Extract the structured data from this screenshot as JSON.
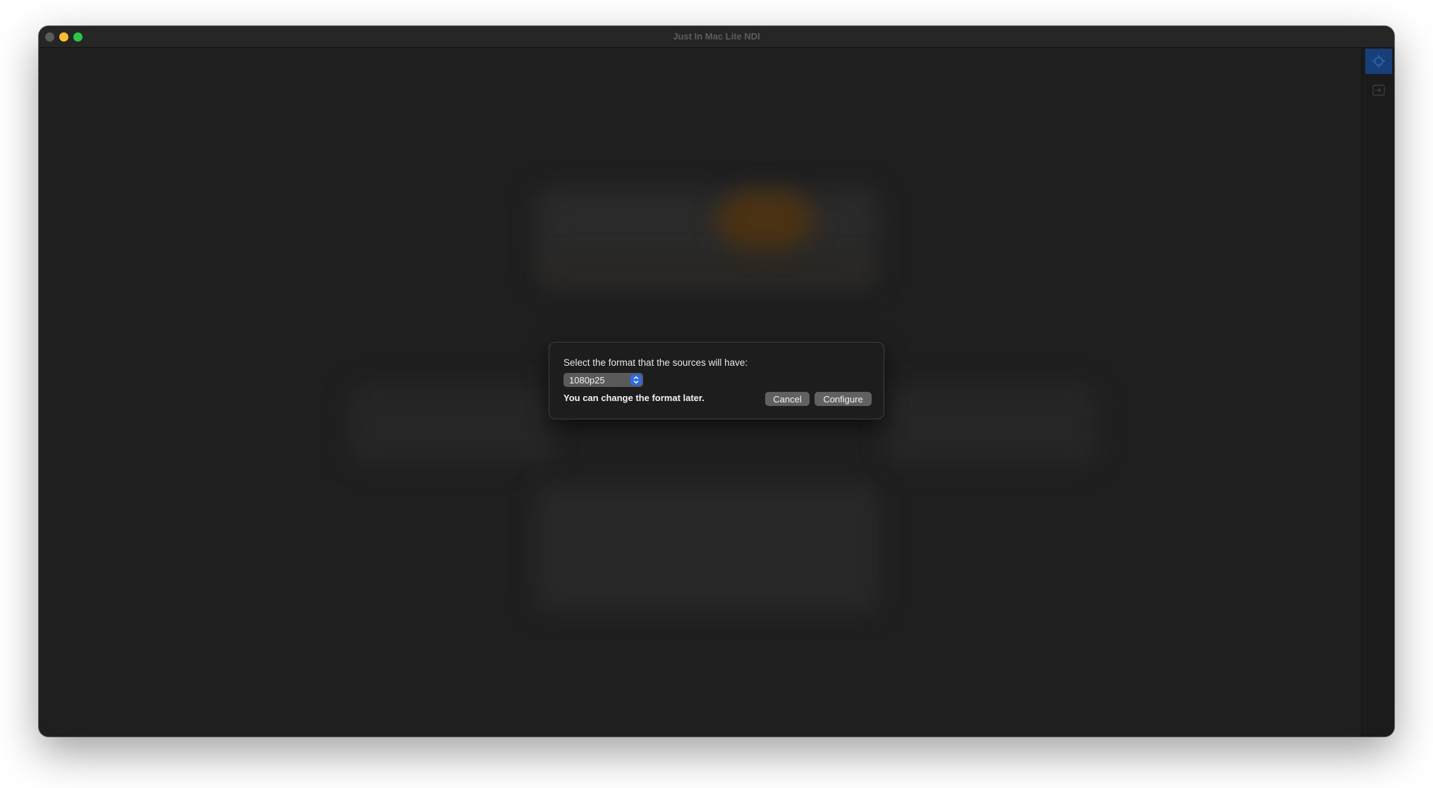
{
  "window": {
    "title": "Just In Mac Lite NDI"
  },
  "sidebar": {
    "items": [
      {
        "icon": "gear-icon",
        "active": true
      },
      {
        "icon": "input-icon",
        "active": false
      }
    ]
  },
  "dialog": {
    "prompt": "Select the format that the sources will have:",
    "format_select": {
      "value": "1080p25",
      "icon": "up-down-chevron-icon"
    },
    "hint": "You can change the format later.",
    "cancel_label": "Cancel",
    "configure_label": "Configure"
  },
  "colors": {
    "accent": "#2c6be0",
    "window_bg": "#1f1f1f",
    "traffic_min": "#febc2e",
    "traffic_max": "#28c840"
  }
}
